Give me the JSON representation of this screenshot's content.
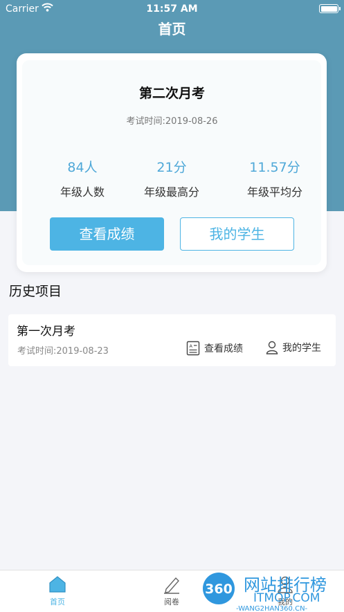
{
  "status_bar": {
    "carrier": "Carrier",
    "time": "11:57 AM"
  },
  "nav": {
    "title": "首页"
  },
  "current_exam": {
    "name": "第二次月考",
    "date": "考试时间:2019-08-26",
    "stats": [
      {
        "value": "84人",
        "label": "年级人数"
      },
      {
        "value": "21分",
        "label": "年级最高分"
      },
      {
        "value": "11.57分",
        "label": "年级平均分"
      }
    ],
    "view_scores_label": "查看成绩",
    "my_students_label": "我的学生"
  },
  "history": {
    "title": "历史项目",
    "items": [
      {
        "name": "第一次月考",
        "date": "考试时间:2019-08-23",
        "view_scores_label": "查看成绩",
        "my_students_label": "我的学生"
      }
    ]
  },
  "tabbar": {
    "tabs": [
      {
        "label": "首页",
        "icon": "home-icon",
        "active": true
      },
      {
        "label": "阅卷",
        "icon": "pen-icon",
        "active": false
      },
      {
        "label": "我的",
        "icon": "user-icon",
        "active": false
      }
    ]
  },
  "watermark": {
    "badge": "360",
    "title": "网站排行榜",
    "domain": "ITMOP.COM",
    "subdomain": "-WANG2HAN360.CN-"
  },
  "colors": {
    "header": "#5b9ab5",
    "accent": "#4db4e4",
    "stat_value": "#4fa8d8",
    "watermark_blue": "#1e8fdc"
  }
}
